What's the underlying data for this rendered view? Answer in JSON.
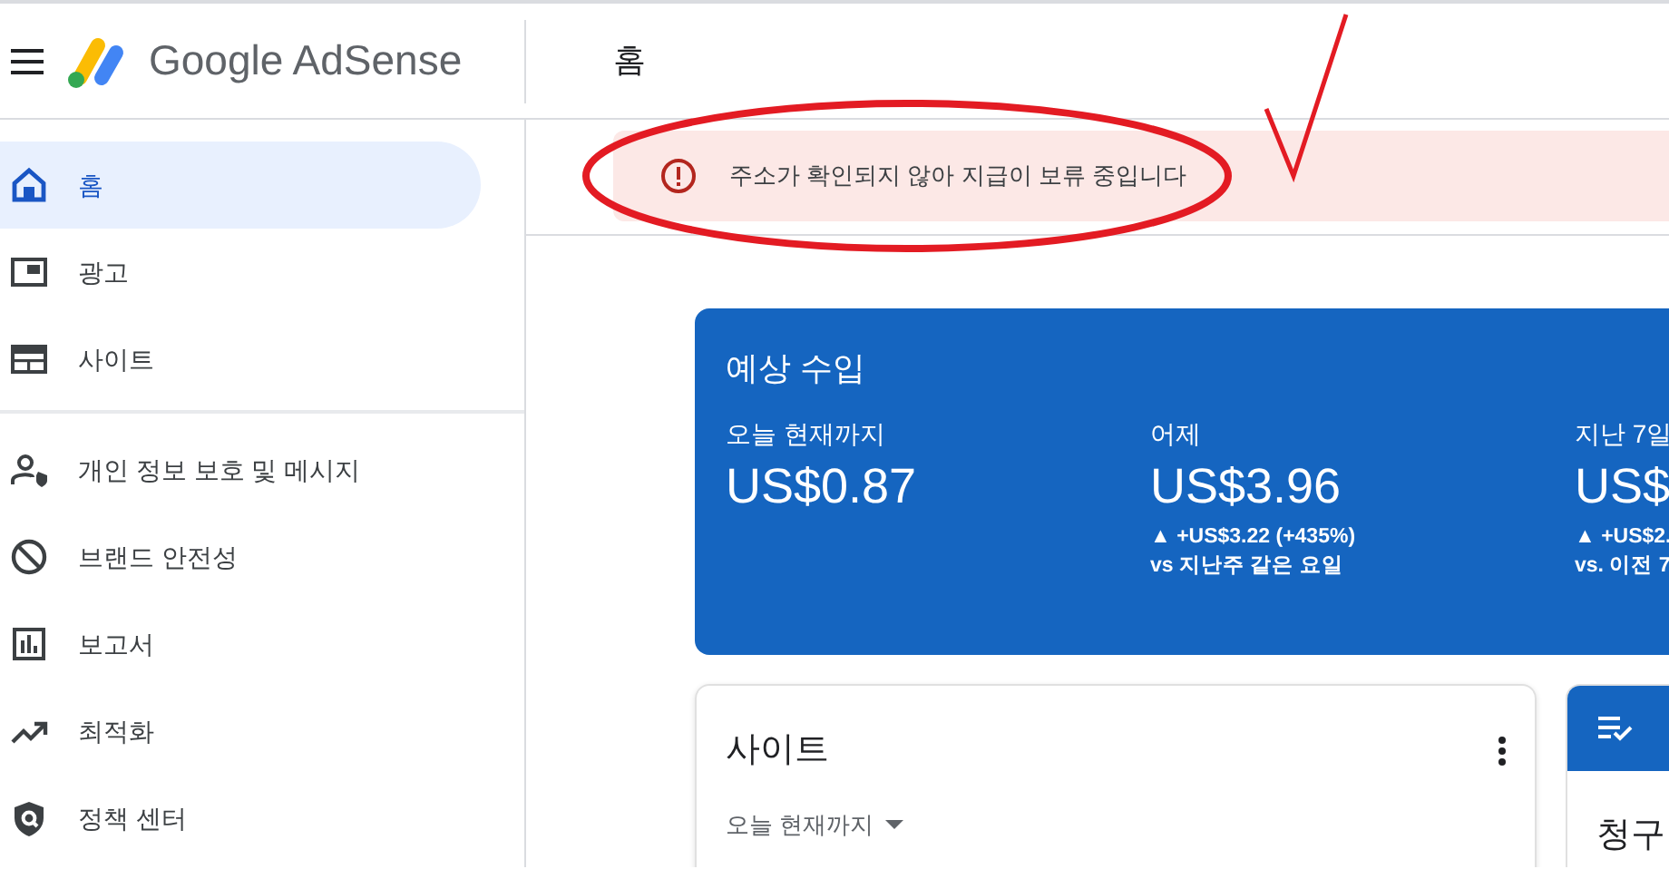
{
  "header": {
    "product": "Google AdSense",
    "page_title": "홈"
  },
  "sidebar": {
    "groups": [
      [
        {
          "label": "홈",
          "kind": "home",
          "selected": true
        },
        {
          "label": "광고",
          "kind": "ads",
          "selected": false
        },
        {
          "label": "사이트",
          "kind": "sites",
          "selected": false
        }
      ],
      [
        {
          "label": "개인 정보 보호 및 메시지",
          "kind": "privacy",
          "selected": false
        },
        {
          "label": "브랜드 안전성",
          "kind": "block",
          "selected": false
        },
        {
          "label": "보고서",
          "kind": "report",
          "selected": false
        },
        {
          "label": "최적화",
          "kind": "trend",
          "selected": false
        },
        {
          "label": "정책 센터",
          "kind": "policy",
          "selected": false
        }
      ]
    ]
  },
  "alert": {
    "message": "주소가 확인되지 않아 지급이 보류 중입니다"
  },
  "earnings": {
    "title": "예상 수입",
    "columns": [
      {
        "label": "오늘 현재까지",
        "value": "US$0.87"
      },
      {
        "label": "어제",
        "value": "US$3.96",
        "change": "▲ +US$3.22 (+435%)",
        "compare": "vs 지난주 같은 요일"
      },
      {
        "label": "지난 7일",
        "value": "US$",
        "change": "▲ +US$2.",
        "compare": "vs. 이전 7"
      }
    ]
  },
  "sites_card": {
    "title": "사이트",
    "range": "오늘 현재까지"
  },
  "billing_card": {
    "title": "청구"
  }
}
